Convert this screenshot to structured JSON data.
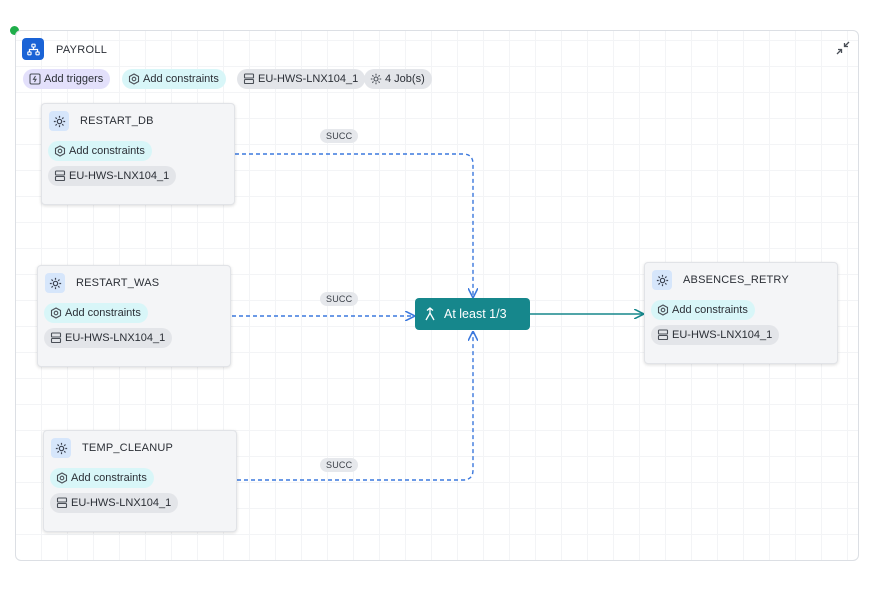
{
  "flow": {
    "title": "PAYROLL",
    "chips": {
      "triggers": "Add triggers",
      "constraints": "Add constraints",
      "agent": "EU-HWS-LNX104_1",
      "jobs": "4 Job(s)"
    }
  },
  "jobs": [
    {
      "name": "RESTART_DB",
      "constraints": "Add constraints",
      "agent": "EU-HWS-LNX104_1"
    },
    {
      "name": "RESTART_WAS",
      "constraints": "Add constraints",
      "agent": "EU-HWS-LNX104_1"
    },
    {
      "name": "TEMP_CLEANUP",
      "constraints": "Add constraints",
      "agent": "EU-HWS-LNX104_1"
    },
    {
      "name": "ABSENCES_RETRY",
      "constraints": "Add constraints",
      "agent": "EU-HWS-LNX104_1"
    }
  ],
  "edges": [
    {
      "label": "SUCC"
    },
    {
      "label": "SUCC"
    },
    {
      "label": "SUCC"
    }
  ],
  "gate": {
    "label": "At least 1/3"
  },
  "colors": {
    "accent": "#1a63d6",
    "gate": "#16878c",
    "status": "#1fae4a",
    "edge_dashed": "#3b78dd"
  },
  "icons": [
    "status-dot",
    "flow-icon",
    "collapse-icon",
    "trigger-icon",
    "constraint-icon",
    "agent-icon",
    "gear-icon",
    "gate-icon"
  ]
}
